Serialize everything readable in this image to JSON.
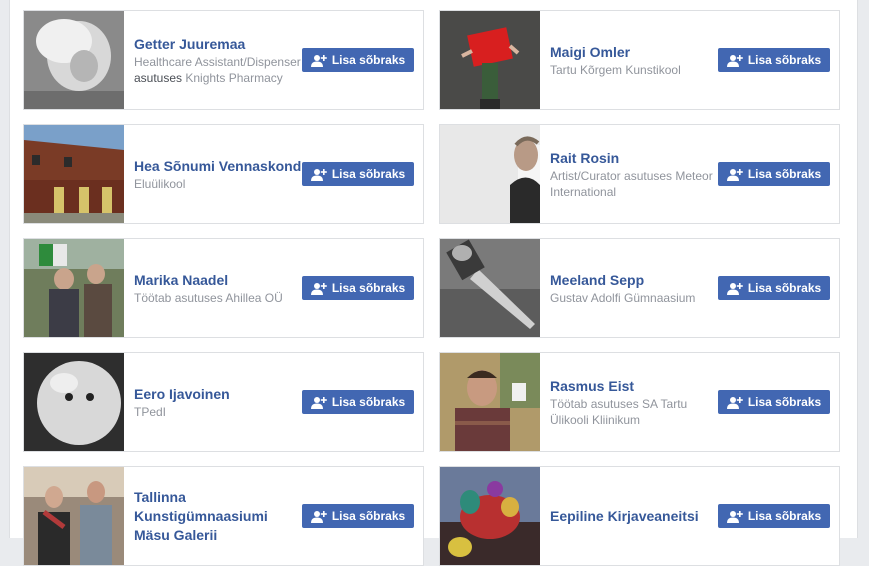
{
  "button_label": "Lisa sõbraks",
  "cards": [
    {
      "name": "Getter Juuremaa",
      "line1": "Healthcare Assistant/Dispenser",
      "line2_prefix": "asutuses",
      "line2_rest": " Knights Pharmacy"
    },
    {
      "name": "Maigi Omler",
      "line1": "Tartu Kõrgem Kunstikool",
      "line2_prefix": "",
      "line2_rest": ""
    },
    {
      "name": "Hea Sõnumi Vennaskond",
      "line1": "Eluülikool",
      "line2_prefix": "",
      "line2_rest": ""
    },
    {
      "name": "Rait Rosin",
      "line1": "Artist/Curator asutuses Meteor International",
      "line2_prefix": "",
      "line2_rest": ""
    },
    {
      "name": "Marika Naadel",
      "line1": "Töötab asutuses Ahillea OÜ",
      "line2_prefix": "",
      "line2_rest": ""
    },
    {
      "name": "Meeland Sepp",
      "line1": "Gustav Adolfi Gümnaasium",
      "line2_prefix": "",
      "line2_rest": ""
    },
    {
      "name": "Eero Ijavoinen",
      "line1": "TPedI",
      "line2_prefix": "",
      "line2_rest": ""
    },
    {
      "name": "Rasmus Eist",
      "line1": "Töötab asutuses SA Tartu Ülikooli Kliinikum",
      "line2_prefix": "",
      "line2_rest": ""
    },
    {
      "name": "Tallinna Kunstigümnaasiumi Mäsu Galerii",
      "line1": "",
      "line2_prefix": "",
      "line2_rest": ""
    },
    {
      "name": "Eepiline Kirjaveaneitsi",
      "line1": "",
      "line2_prefix": "",
      "line2_rest": ""
    }
  ]
}
